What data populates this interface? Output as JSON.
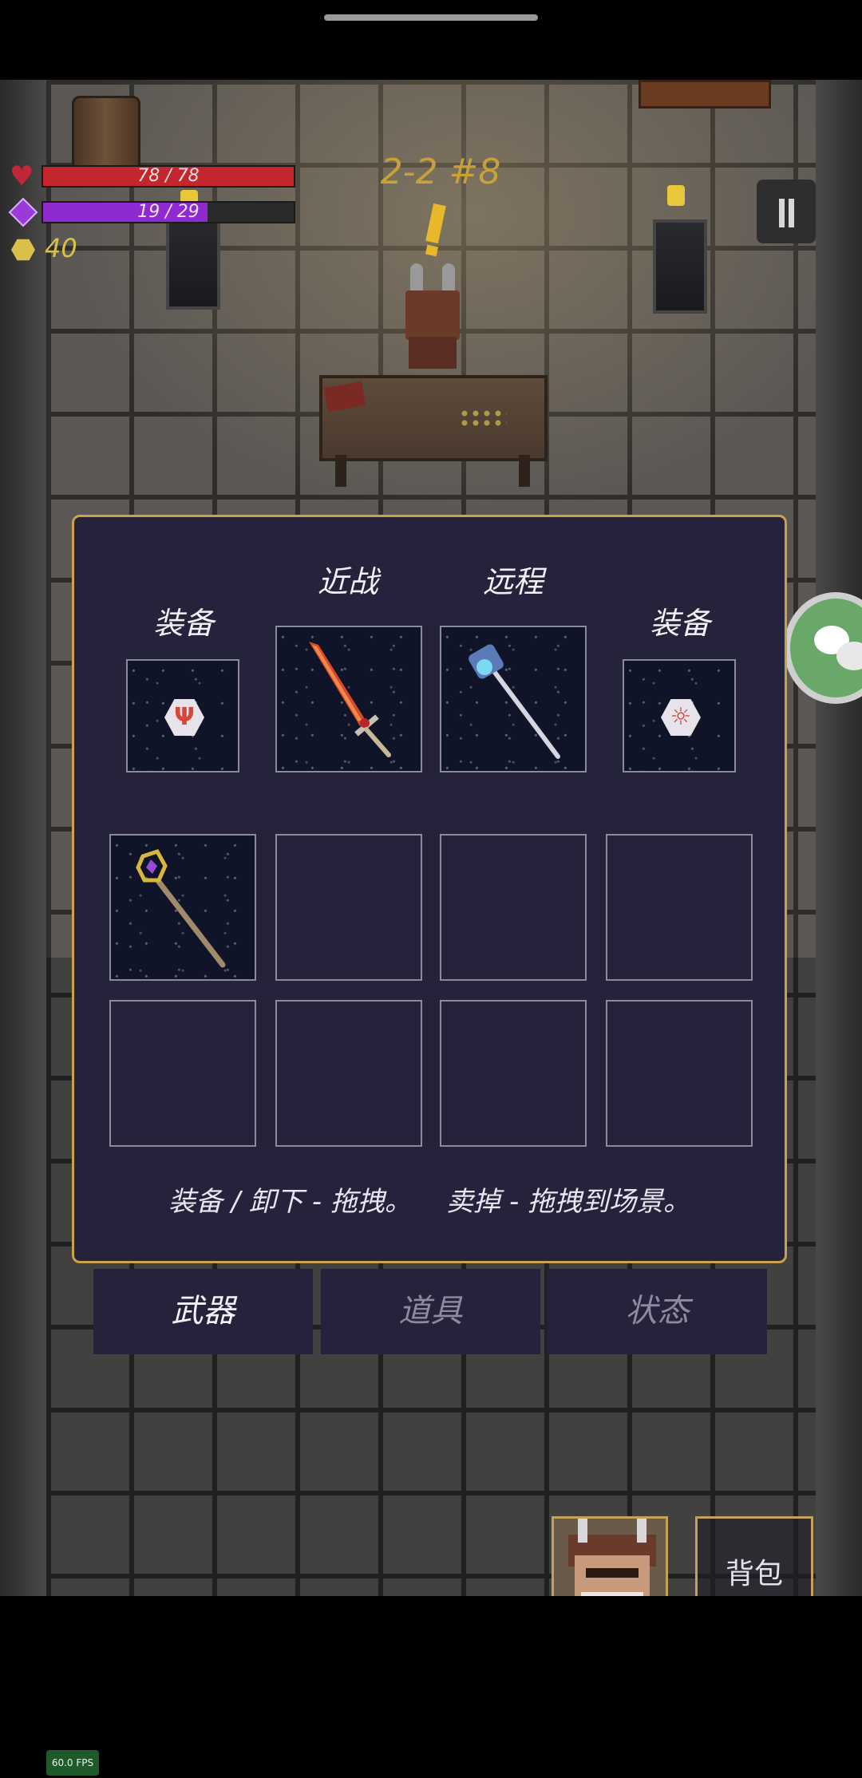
{
  "hud": {
    "hp_text": "78 / 78",
    "hp_fraction": 1.0,
    "mp_text": "19 / 29",
    "mp_fraction": 0.655,
    "gold": "40",
    "stage": "2-2 #8"
  },
  "inventory": {
    "headers": {
      "melee": "近战",
      "ranged": "远程",
      "equip_left": "装备",
      "equip_right": "装备"
    },
    "equipped": [
      {
        "slot": "equip-left",
        "item_icon": "rune-trident-icon"
      },
      {
        "slot": "melee",
        "item_icon": "flame-sword-icon"
      },
      {
        "slot": "ranged",
        "item_icon": "ice-staff-icon"
      },
      {
        "slot": "equip-right",
        "item_icon": "rune-sun-icon"
      }
    ],
    "bag_slots": [
      {
        "item_icon": "amethyst-staff-icon"
      },
      {
        "item_icon": ""
      },
      {
        "item_icon": ""
      },
      {
        "item_icon": ""
      },
      {
        "item_icon": ""
      },
      {
        "item_icon": ""
      },
      {
        "item_icon": ""
      },
      {
        "item_icon": ""
      }
    ],
    "hint": "装备 / 卸下 - 拖拽。    卖掉 - 拖拽到场景。"
  },
  "tabs": [
    {
      "label": "武器",
      "active": true
    },
    {
      "label": "道具",
      "active": false
    },
    {
      "label": "状态",
      "active": false
    }
  ],
  "bottom": {
    "backpack_label": "背包"
  },
  "fps": "60.0 FPS",
  "colors": {
    "hp": "#c4262e",
    "mp": "#8e2ad0",
    "gold": "#d8c04a",
    "panel": "#25223b",
    "panel_border": "#caa24a"
  }
}
